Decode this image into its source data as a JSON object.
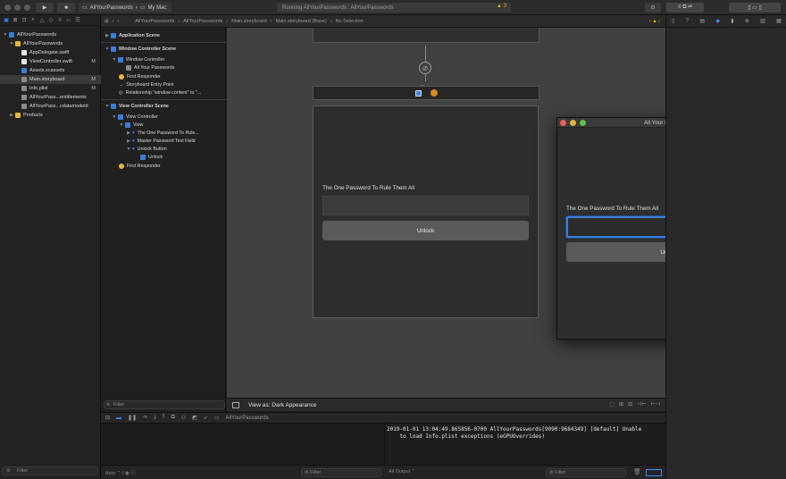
{
  "toolbar": {
    "scheme_target": "AllYourPasswords",
    "scheme_device": "My Mac",
    "activity_status": "Running AllYourPasswords : AllYourPasswords",
    "warning_count": "3"
  },
  "navigator": {
    "tree": [
      {
        "label": "AllYourPasswords",
        "badge": "",
        "icon": "project-icon"
      },
      {
        "label": "AllYourPasswords",
        "badge": "",
        "icon": "folder-icon"
      },
      {
        "label": "AppDelegate.swift",
        "badge": "",
        "icon": "swift-file-icon"
      },
      {
        "label": "ViewController.swift",
        "badge": "M",
        "icon": "swift-file-icon"
      },
      {
        "label": "Assets.xcassets",
        "badge": "",
        "icon": "assets-icon"
      },
      {
        "label": "Main.storyboard",
        "badge": "M",
        "icon": "storyboard-icon"
      },
      {
        "label": "Info.plist",
        "badge": "M",
        "icon": "plist-icon"
      },
      {
        "label": "AllYourPass...entitlements",
        "badge": "",
        "icon": "entitlements-icon"
      },
      {
        "label": "AllYourPass...cdatamodeld",
        "badge": "",
        "icon": "datamodel-icon"
      },
      {
        "label": "Products",
        "badge": "",
        "icon": "folder-icon"
      }
    ],
    "filter_placeholder": "Filter"
  },
  "jumpbar": {
    "crumbs": [
      "AllYourPasswords",
      "AllYourPasswords",
      "Main.storyboard",
      "Main.storyboard (Base)",
      "No Selection"
    ]
  },
  "outline": {
    "rows": [
      {
        "label": "Application Scene",
        "bold": true
      },
      {
        "label": "Window Controller Scene",
        "bold": true
      },
      {
        "label": "Window Controller",
        "bold": false
      },
      {
        "label": "All Your Passwords",
        "bold": false
      },
      {
        "label": "First Responder",
        "bold": false
      },
      {
        "label": "Storyboard Entry Point",
        "bold": false
      },
      {
        "label": "Relationship \"window content\" to \"...",
        "bold": false
      },
      {
        "label": "View Controller Scene",
        "bold": true
      },
      {
        "label": "View Controller",
        "bold": false
      },
      {
        "label": "View",
        "bold": false
      },
      {
        "label": "The One Password To Rule...",
        "bold": false
      },
      {
        "label": "Master Password Text Field",
        "bold": false
      },
      {
        "label": "Unlock Button",
        "bold": false
      },
      {
        "label": "Unlock",
        "bold": false
      },
      {
        "label": "First Responder",
        "bold": false
      }
    ],
    "filter_placeholder": "Filter"
  },
  "canvas": {
    "vc_label": "The One Password To Rule Them All",
    "vc_button": "Unlock",
    "view_as": "View as: Dark Appearance"
  },
  "window": {
    "title": "All Your Passwords",
    "label": "The One Password To Rule Them All",
    "button": "Unlock"
  },
  "debug": {
    "target": "AllYourPasswords",
    "console_text": "2019-01-01 13:04:49.865856-0700 AllYourPasswords[9090:9684349] [default] Unable\n    to load Info.plist exceptions (eGPUOverrides)",
    "auto_label": "Auto",
    "var_filter": "Filter",
    "output_label": "All Output",
    "console_filter": "Filter"
  },
  "colors": {
    "accent": "#3f89ff",
    "warning": "#e6b400",
    "close": "#ec5f57",
    "minimize": "#e1b43c",
    "zoom": "#5fc04e"
  }
}
